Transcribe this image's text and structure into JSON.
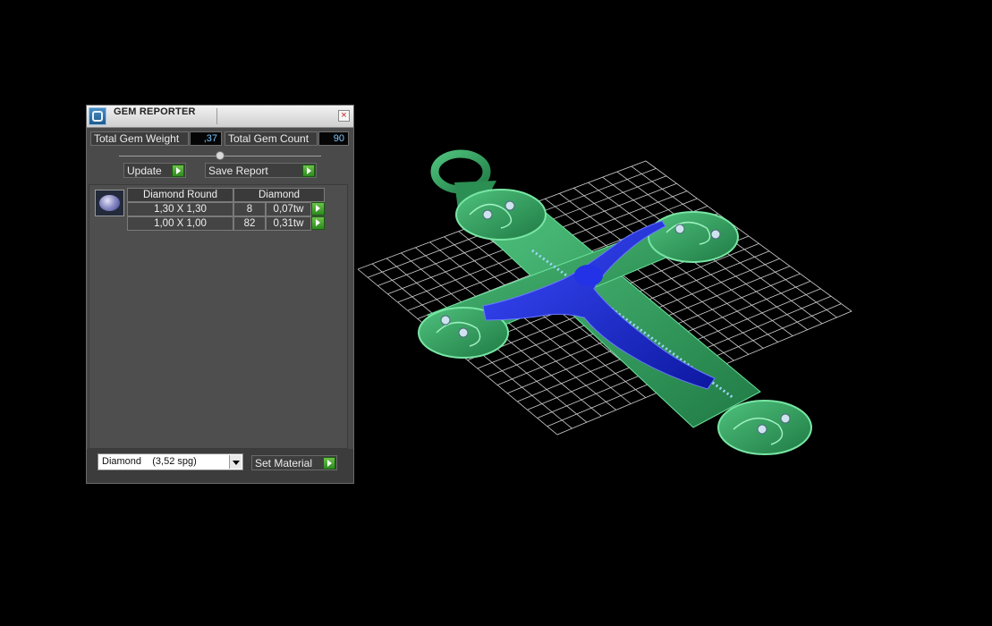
{
  "panel": {
    "title": "GEM REPORTER",
    "close_glyph": "×",
    "total_gem_weight_label": "Total Gem Weight",
    "total_gem_weight_value": ",37",
    "total_gem_count_label": "Total Gem Count",
    "total_gem_count_value": "90",
    "update_label": "Update",
    "save_report_label": "Save Report",
    "table": {
      "headers": [
        "Diamond Round",
        "Diamond"
      ],
      "rows": [
        {
          "size": "1,30 X 1,30",
          "count": "8",
          "weight": "0,07tw"
        },
        {
          "size": "1,00 X 1,00",
          "count": "82",
          "weight": "0,31tw"
        }
      ]
    },
    "material_select": {
      "name": "Diamond",
      "spg": "(3,52 spg)"
    },
    "set_material_label": "Set Material"
  },
  "icons": {
    "app": "gem-reporter-icon",
    "close": "close-icon",
    "go": "green-play-arrow-icon",
    "gem": "oval-gem-icon",
    "dropdown": "chevron-down-icon"
  },
  "colors": {
    "background": "#000000",
    "panel": "#4a4a4a",
    "value_text": "#7cc7ff",
    "go_button": "#3fa52a",
    "model_metal": "#2e9a5a",
    "model_figure": "#1b2cd6",
    "grid": "#cfcfcf"
  }
}
